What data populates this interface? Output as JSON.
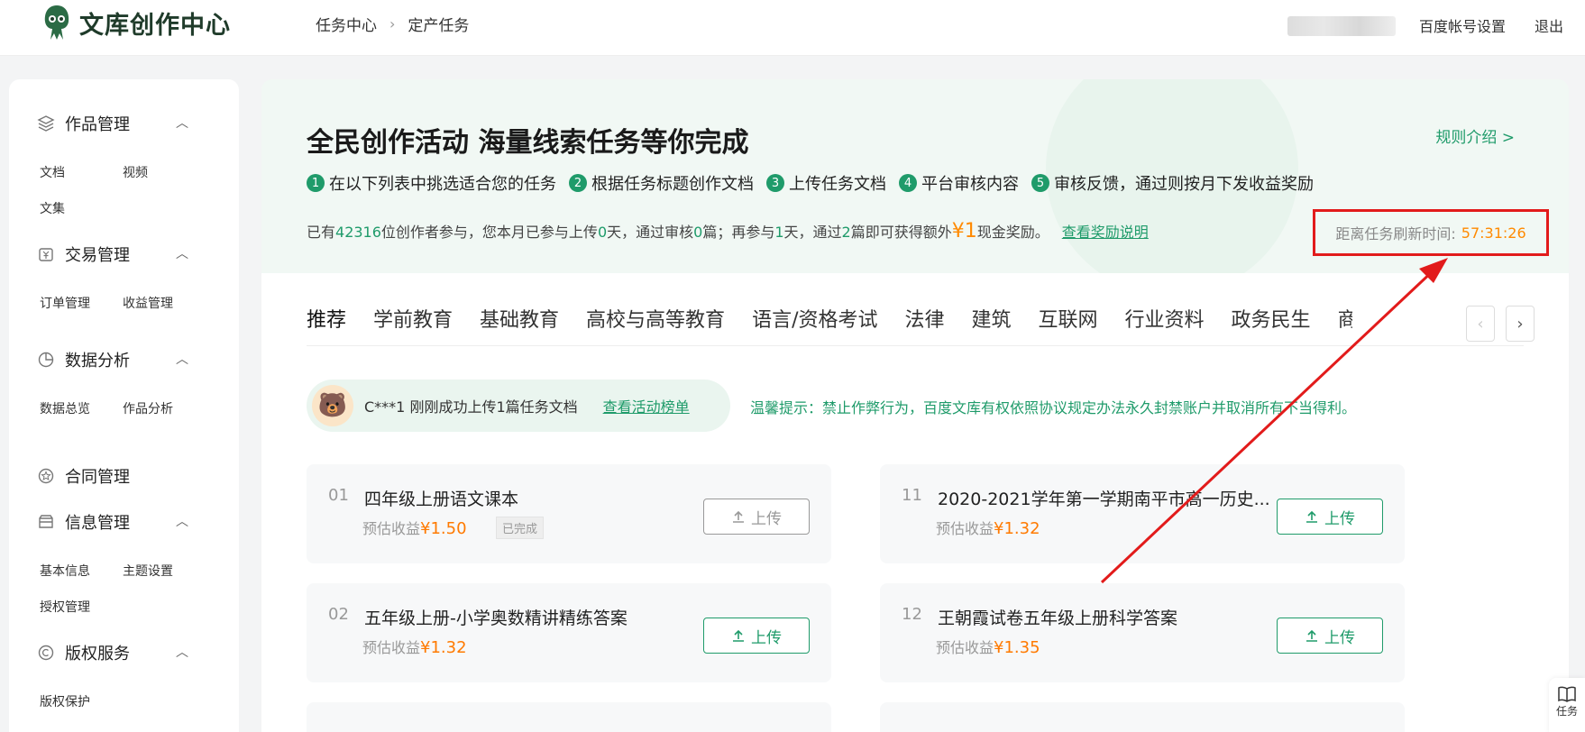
{
  "header": {
    "logo_text": "文库创作中心",
    "breadcrumb": [
      "任务中心",
      "定产任务"
    ],
    "account_settings": "百度帐号设置",
    "logout": "退出"
  },
  "sidebar": {
    "sections": [
      {
        "label": "作品管理",
        "icon": "layers-icon",
        "items": [
          "文档",
          "视频",
          "文集"
        ]
      },
      {
        "label": "交易管理",
        "icon": "yuan-icon",
        "items": [
          "订单管理",
          "收益管理"
        ]
      },
      {
        "label": "数据分析",
        "icon": "pie-icon",
        "items": [
          "数据总览",
          "作品分析"
        ]
      },
      {
        "label": "合同管理",
        "icon": "star-icon",
        "items": []
      },
      {
        "label": "信息管理",
        "icon": "folder-icon",
        "items": [
          "基本信息",
          "主题设置",
          "授权管理"
        ]
      },
      {
        "label": "版权服务",
        "icon": "copyright-icon",
        "items": [
          "版权保护"
        ]
      }
    ]
  },
  "banner": {
    "title": "全民创作活动 海量线索任务等你完成",
    "rule_link": "规则介绍 >",
    "steps": [
      {
        "num": "1",
        "text": "在以下列表中挑选适合您的任务"
      },
      {
        "num": "2",
        "text": "根据任务标题创作文档"
      },
      {
        "num": "3",
        "text": "上传任务文档"
      },
      {
        "num": "4",
        "text": "平台审核内容"
      },
      {
        "num": "5",
        "text": "审核反馈，通过则按月下发收益奖励"
      }
    ],
    "stats": {
      "p1": "已有",
      "participants": "42316",
      "p2": "位创作者参与，您本月已参与上传",
      "upload_days": "0",
      "p3": "天，通过审核",
      "passed": "0",
      "p4": "篇；再参与",
      "more_days": "1",
      "p5": "天，通过",
      "more_docs": "2",
      "p6": "篇即可获得额外",
      "reward": "¥1",
      "p7": "现金奖励。",
      "link": "查看奖励说明"
    },
    "countdown_label": "距离任务刷新时间:",
    "countdown_value": "57:31:26"
  },
  "tabs": [
    "推荐",
    "学前教育",
    "基础教育",
    "高校与高等教育",
    "语言/资格考试",
    "法律",
    "建筑",
    "互联网",
    "行业资料",
    "政务民生",
    "商品说明书"
  ],
  "notice": {
    "message": "C***1 刚刚成功上传1篇任务文档",
    "link": "查看活动榜单",
    "tip": "温馨提示：禁止作弊行为，百度文库有权依照协议规定办法永久封禁账户并取消所有不当得利。"
  },
  "tasks": [
    {
      "no": "01",
      "title": "四年级上册语文课本",
      "earn_label": "预估收益",
      "price": "¥1.50",
      "status": "已完成",
      "button": "上传"
    },
    {
      "no": "11",
      "title": "2020-2021学年第一学期南平市高一历史...",
      "earn_label": "预估收益",
      "price": "¥1.32",
      "button": "上传"
    },
    {
      "no": "02",
      "title": "五年级上册-小学奥数精讲精练答案",
      "earn_label": "预估收益",
      "price": "¥1.32",
      "button": "上传"
    },
    {
      "no": "12",
      "title": "王朝霞试卷五年级上册科学答案",
      "earn_label": "预估收益",
      "price": "¥1.35",
      "button": "上传"
    }
  ],
  "float_button_label": "任务",
  "colors": {
    "accent": "#1f9b6a",
    "price": "#ff7a00",
    "annotation": "#e21b1b"
  }
}
